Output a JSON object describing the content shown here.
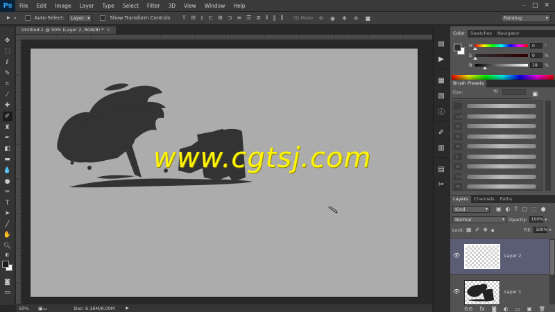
{
  "app": {
    "logo": "Ps"
  },
  "menu": [
    "File",
    "Edit",
    "Image",
    "Layer",
    "Type",
    "Select",
    "Filter",
    "3D",
    "View",
    "Window",
    "Help"
  ],
  "window_controls": {
    "minimize": "–",
    "maximize": "□",
    "close": "✕"
  },
  "options": {
    "move_tool_glyph": "▸",
    "auto_select_label": "Auto-Select:",
    "auto_select_value": "Layer",
    "show_transform_label": "Show Transform Controls",
    "mode3d_label": "3D Mode:",
    "workspace": "Painting"
  },
  "document": {
    "tab_title": "Untitled-1 @ 50% (Layer 2, RGB/8) *",
    "close_glyph": "×",
    "watermark": "www.cgtsj.com"
  },
  "status": {
    "zoom": "50%",
    "doc_info": "Doc: 6.16M/8.00M",
    "arrow": "▶"
  },
  "color_panel": {
    "tabs": [
      "Color",
      "Swatches",
      "Navigator"
    ],
    "active_tab": "Color",
    "h": {
      "letter": "H",
      "value": "0",
      "unit": "°",
      "level": 0.0
    },
    "s": {
      "letter": "S",
      "value": "0",
      "unit": "%",
      "level": 0.0
    },
    "b": {
      "letter": "B",
      "value": "18",
      "unit": "%",
      "level": 0.18
    },
    "fg_color": "#2e2e2e",
    "bg_color": "#ffffff"
  },
  "brush_panel": {
    "title": "Brush Presets",
    "size_label": "Size:",
    "sizes": [
      "",
      "120",
      "60",
      "60",
      "60",
      "6",
      "60",
      "250",
      "40"
    ]
  },
  "layers_panel": {
    "tabs": [
      "Layers",
      "Channels",
      "Paths"
    ],
    "active_tab": "Layers",
    "kind_label": "Kind",
    "blend_mode": "Normal",
    "opacity_label": "Opacity:",
    "opacity_value": "100%",
    "lock_label": "Lock:",
    "fill_label": "Fill:",
    "fill_value": "100%",
    "layers": [
      {
        "name": "Layer 2",
        "selected": true
      },
      {
        "name": "Layer 1",
        "selected": false
      }
    ]
  },
  "icons": {
    "toolbar": [
      "move-icon",
      "marquee-icon",
      "lasso-icon",
      "quick-select-icon",
      "crop-icon",
      "eyedropper-icon",
      "healing-icon",
      "brush-icon",
      "stamp-icon",
      "history-brush-icon",
      "eraser-icon",
      "gradient-icon",
      "blur-icon",
      "dodge-icon",
      "pen-icon",
      "type-icon",
      "path-select-icon",
      "shape-icon",
      "hand-icon",
      "zoom-icon"
    ]
  }
}
